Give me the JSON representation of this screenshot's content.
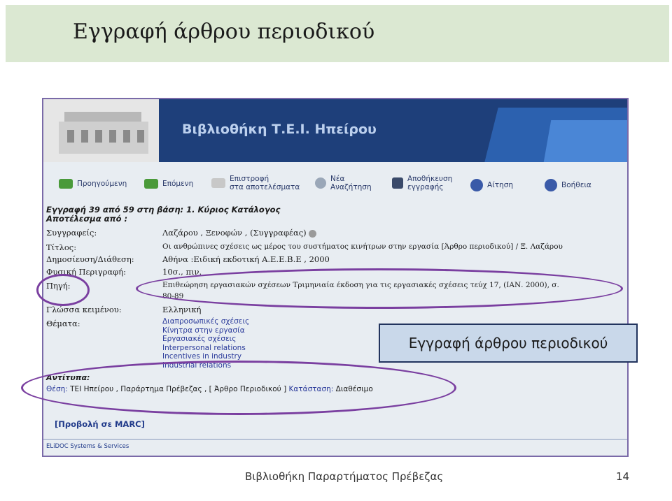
{
  "slide": {
    "title": "Εγγραφή άρθρου περιοδικού",
    "callout": "Εγγραφή άρθρου περιοδικού",
    "footer_left": "Βιβλιοθήκη Παραρτήματος Πρέβεζας",
    "page_number": "14"
  },
  "opac": {
    "banner_title": "Βιβλιοθήκη Τ.Ε.Ι. Ηπείρου",
    "toolbar": [
      {
        "label": "Προηγούμενη",
        "icon": "prev-icon"
      },
      {
        "label": "Επόμενη",
        "icon": "next-icon"
      },
      {
        "label1": "Επιστροφή",
        "label2": "στα αποτελέσματα",
        "icon": "results-list-icon"
      },
      {
        "label1": "Νέα",
        "label2": "Αναζήτηση",
        "icon": "magnifier-icon"
      },
      {
        "label1": "Αποθήκευση",
        "label2": "εγγραφής",
        "icon": "floppy-disk-icon"
      },
      {
        "label": "Αίτηση",
        "icon": "check-icon"
      },
      {
        "label": "Βοήθεια",
        "icon": "question-icon"
      }
    ],
    "record_header_1": "Εγγραφή 39 από 59 στη βάση: 1. Κύριος Κατάλογος",
    "record_header_2": "Αποτέλεσμα από :",
    "fields": [
      {
        "label": "Συγγραφείς:",
        "value": "Λαζάρου , Ξενοφών , (Συγγραφέας)"
      },
      {
        "label": "Τίτλος:",
        "value": "Οι ανθρώπινες σχέσεις ως μέρος του συστήματος κινήτρων στην εργασία [Άρθρο περιοδικού] / Ξ. Λαζάρου"
      },
      {
        "label": "Δημοσίευση/Διάθεση:",
        "value": "Αθήνα :Ειδική εκδοτική Α.Ε.Ε.Β.Ε , 2000"
      },
      {
        "label": "Φυσική Περιγραφή:",
        "value": "10σ., πιν."
      },
      {
        "label": "Πηγή:",
        "value": "Επιθεώρηση εργασιακών σχέσεων Τριμηνιαία έκδοση για τις εργασιακές σχέσεις τεύχ 17, (ΙΑΝ. 2000), σ.",
        "value2": "80-89"
      },
      {
        "label": "Γλώσσα κειμένου:",
        "value": "Ελληνική"
      },
      {
        "label": "Θέματα:",
        "value": ""
      }
    ],
    "subjects": [
      "Διαπροσωπικές σχέσεις",
      "Κίνητρα στην εργασία",
      "Εργασιακές σχέσεις",
      "Interpersonal relations",
      "Incentives in industry",
      "Industrial relations"
    ],
    "copies_header": "Αντίτυπα:",
    "copies_location_label": "Θέση:",
    "copies_location_value": "ΤΕΙ Ηπείρου , Παράρτημα Πρέβεζας , [ Άρθρο Περιοδικού ]",
    "copies_status_label": "Κατάσταση:",
    "copies_status_value": "Διαθέσιμο",
    "marc_link": "[Προβολή σε MARC]",
    "footer": "ELiDOC Systems & Services"
  }
}
